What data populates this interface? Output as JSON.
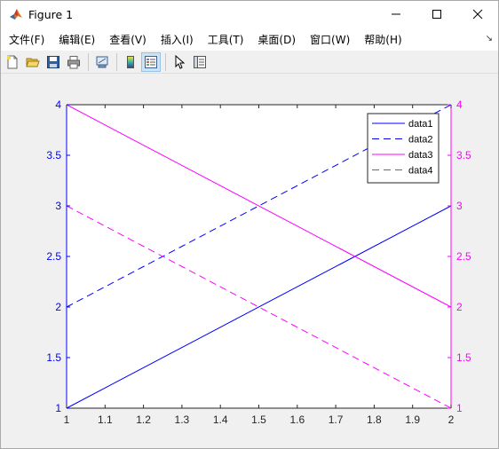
{
  "window": {
    "title": "Figure 1",
    "controls": {
      "minimize": "—",
      "maximize": "☐",
      "close": "✕"
    }
  },
  "menu": {
    "items": [
      {
        "label": "文件(F)"
      },
      {
        "label": "编辑(E)"
      },
      {
        "label": "查看(V)"
      },
      {
        "label": "插入(I)"
      },
      {
        "label": "工具(T)"
      },
      {
        "label": "桌面(D)"
      },
      {
        "label": "窗口(W)"
      },
      {
        "label": "帮助(H)"
      }
    ],
    "dock_arrow": "↘"
  },
  "toolbar": {
    "buttons": [
      {
        "icon": "new-figure-icon"
      },
      {
        "icon": "open-file-icon"
      },
      {
        "icon": "save-icon"
      },
      {
        "icon": "print-icon"
      },
      {
        "icon": "link-plot-icon"
      },
      {
        "icon": "colorbar-icon"
      },
      {
        "icon": "legend-icon",
        "active": true
      },
      {
        "icon": "pointer-icon"
      },
      {
        "icon": "property-inspector-icon"
      }
    ]
  },
  "colors": {
    "left_axis": "#0000ff",
    "right_axis": "#ff00ff",
    "plot_bg": "#ffffff",
    "x_axis": "#262626"
  },
  "chart_data": {
    "type": "line",
    "title": "",
    "xlabel": "",
    "ylabel": "",
    "xlim": [
      1,
      2
    ],
    "ylim_left": [
      1,
      4
    ],
    "ylim_right": [
      1,
      4
    ],
    "x_ticks": [
      "1",
      "1.1",
      "1.2",
      "1.3",
      "1.4",
      "1.5",
      "1.6",
      "1.7",
      "1.8",
      "1.9",
      "2"
    ],
    "y_ticks_left": [
      "1",
      "1.5",
      "2",
      "2.5",
      "3",
      "3.5",
      "4"
    ],
    "y_ticks_right": [
      "1",
      "1.5",
      "2",
      "2.5",
      "3",
      "3.5",
      "4"
    ],
    "grid": false,
    "legend_position": "top-right",
    "series": [
      {
        "name": "data1",
        "axis": "left",
        "style": "solid",
        "x": [
          1,
          2
        ],
        "y": [
          1,
          3
        ]
      },
      {
        "name": "data2",
        "axis": "left",
        "style": "dashed",
        "x": [
          1,
          2
        ],
        "y": [
          2,
          4
        ]
      },
      {
        "name": "data3",
        "axis": "right",
        "style": "solid",
        "x": [
          1,
          2
        ],
        "y": [
          4,
          2
        ]
      },
      {
        "name": "data4",
        "axis": "right",
        "style": "dashed",
        "x": [
          1,
          2
        ],
        "y": [
          3,
          1
        ]
      }
    ]
  }
}
